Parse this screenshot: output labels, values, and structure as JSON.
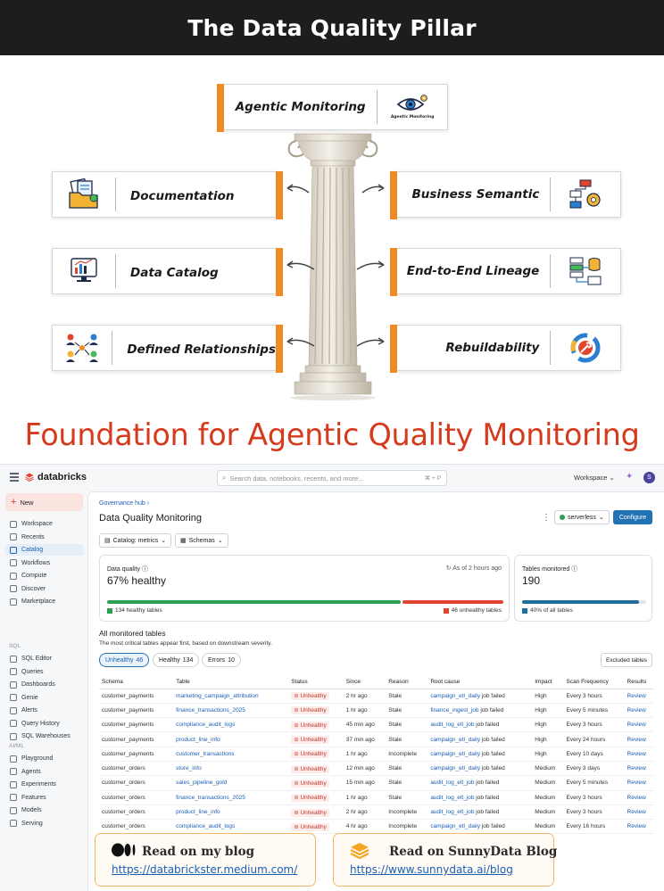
{
  "header": {
    "title": "The Data Quality Pillar"
  },
  "pillar": {
    "top_card": {
      "label": "Agentic Monitoring",
      "icon_caption": "Agentic Monitoring",
      "icon": "eye-gear-icon"
    },
    "left_cards": [
      {
        "label": "Documentation",
        "icon": "documents-folder-icon"
      },
      {
        "label": "Data Catalog",
        "icon": "catalog-screen-icon"
      },
      {
        "label": "Defined Relationships",
        "icon": "people-network-icon"
      }
    ],
    "right_cards": [
      {
        "label": "Business Semantic",
        "icon": "flowchart-gear-icon"
      },
      {
        "label": "End-to-End Lineage",
        "icon": "servers-lineage-icon"
      },
      {
        "label": "Rebuildability",
        "icon": "wrench-cycle-icon"
      }
    ],
    "accent_color": "#f08a24"
  },
  "foundation": {
    "title": "Foundation for Agentic Quality Monitoring",
    "color": "#d63a1c"
  },
  "app": {
    "brand": "databricks",
    "search_placeholder": "Search data, notebooks, recents, and more...",
    "search_shortcut": "⌘ + P",
    "workspace": "Workspace",
    "avatar_initial": "S",
    "sidebar": {
      "new_label": "New",
      "items_main": [
        "Workspace",
        "Recents",
        "Catalog",
        "Workflows",
        "Compute",
        "Discover",
        "Marketplace"
      ],
      "section_sql": "SQL",
      "items_sql": [
        "SQL Editor",
        "Queries",
        "Dashboards",
        "Genie",
        "Alerts",
        "Query History",
        "SQL Warehouses"
      ],
      "section_aiml": "AI/ML",
      "items_aiml": [
        "Playground",
        "Agents",
        "Experiments",
        "Features",
        "Models",
        "Serving"
      ]
    },
    "breadcrumb": "Governance hub",
    "page_title": "Data Quality Monitoring",
    "compute": "serverless",
    "configure_label": "Configure",
    "filters": {
      "catalog": "Catalog: metrics",
      "schemas": "Schemas"
    },
    "quality_panel": {
      "title": "Data quality",
      "value": "67% healthy",
      "as_of": "As of 2 hours ago",
      "healthy_fraction": 0.74,
      "healthy_label": "134 healthy tables",
      "unhealthy_label": "46 unhealthy tables",
      "healthy_color": "#2e9e57",
      "unhealthy_color": "#e0452f"
    },
    "tables_panel": {
      "title": "Tables monitored",
      "value": "190",
      "fraction": 0.94,
      "legend": "40% of all tables",
      "color": "#1f6f9c"
    },
    "monitored": {
      "title": "All monitored tables",
      "subtitle": "The most critical tables appear first, based on downstream severity.",
      "pills": [
        {
          "label": "Unhealthy",
          "count": "46"
        },
        {
          "label": "Healthy",
          "count": "134"
        },
        {
          "label": "Errors",
          "count": "10"
        }
      ],
      "excluded_label": "Excluded tables",
      "columns": [
        "Schema",
        "Table",
        "Status",
        "Since",
        "Reason",
        "Root cause",
        "Impact",
        "Scan Frequency",
        "Results"
      ],
      "rows": [
        [
          "customer_payments",
          "marketing_campaign_attribution",
          "Unhealthy",
          "2 hr ago",
          "Stale",
          "campaign_etl_daily",
          "job failed",
          "High",
          "Every 3 hours",
          "Review"
        ],
        [
          "customer_payments",
          "finance_transactions_2025",
          "Unhealthy",
          "1 hr ago",
          "Stale",
          "finance_ingest_job",
          "job failed",
          "High",
          "Every 5 minutes",
          "Review"
        ],
        [
          "customer_payments",
          "compliance_audit_logs",
          "Unhealthy",
          "45 min ago",
          "Stale",
          "audit_log_etl_job",
          "job failed",
          "High",
          "Every 3 hours",
          "Review"
        ],
        [
          "customer_payments",
          "product_line_info",
          "Unhealthy",
          "37 min ago",
          "Stale",
          "campaign_etl_daily",
          "job failed",
          "High",
          "Every 24 hours",
          "Review"
        ],
        [
          "customer_payments",
          "customer_transactions",
          "Unhealthy",
          "1 hr ago",
          "Incomplete",
          "campaign_etl_daily",
          "job failed",
          "High",
          "Every 10 days",
          "Review"
        ],
        [
          "customer_orders",
          "store_info",
          "Unhealthy",
          "12 min ago",
          "Stale",
          "campaign_etl_daily",
          "job failed",
          "Medium",
          "Every 3 days",
          "Review"
        ],
        [
          "customer_orders",
          "sales_pipeline_gold",
          "Unhealthy",
          "15 min ago",
          "Stale",
          "audit_log_etl_job",
          "job failed",
          "Medium",
          "Every 5 minutes",
          "Review"
        ],
        [
          "customer_orders",
          "finance_transactions_2025",
          "Unhealthy",
          "1 hr ago",
          "Stale",
          "audit_log_etl_job",
          "job failed",
          "Medium",
          "Every 3 hours",
          "Review"
        ],
        [
          "customer_orders",
          "product_line_info",
          "Unhealthy",
          "2 hr ago",
          "Incomplete",
          "audit_log_etl_job",
          "job failed",
          "Medium",
          "Every 3 hours",
          "Review"
        ],
        [
          "customer_orders",
          "compliance_audit_logs",
          "Unhealthy",
          "4 hr ago",
          "Incomplete",
          "campaign_etl_daily",
          "job failed",
          "Medium",
          "Every 16 hours",
          "Review"
        ]
      ]
    }
  },
  "blogs": [
    {
      "title": "Read on my blog",
      "url": "https://databrickster.medium.com/",
      "icon": "medium-logo-icon"
    },
    {
      "title": "Read on SunnyData Blog",
      "url": "https://www.sunnydata.ai/blog",
      "icon": "sunnydata-logo-icon"
    }
  ]
}
